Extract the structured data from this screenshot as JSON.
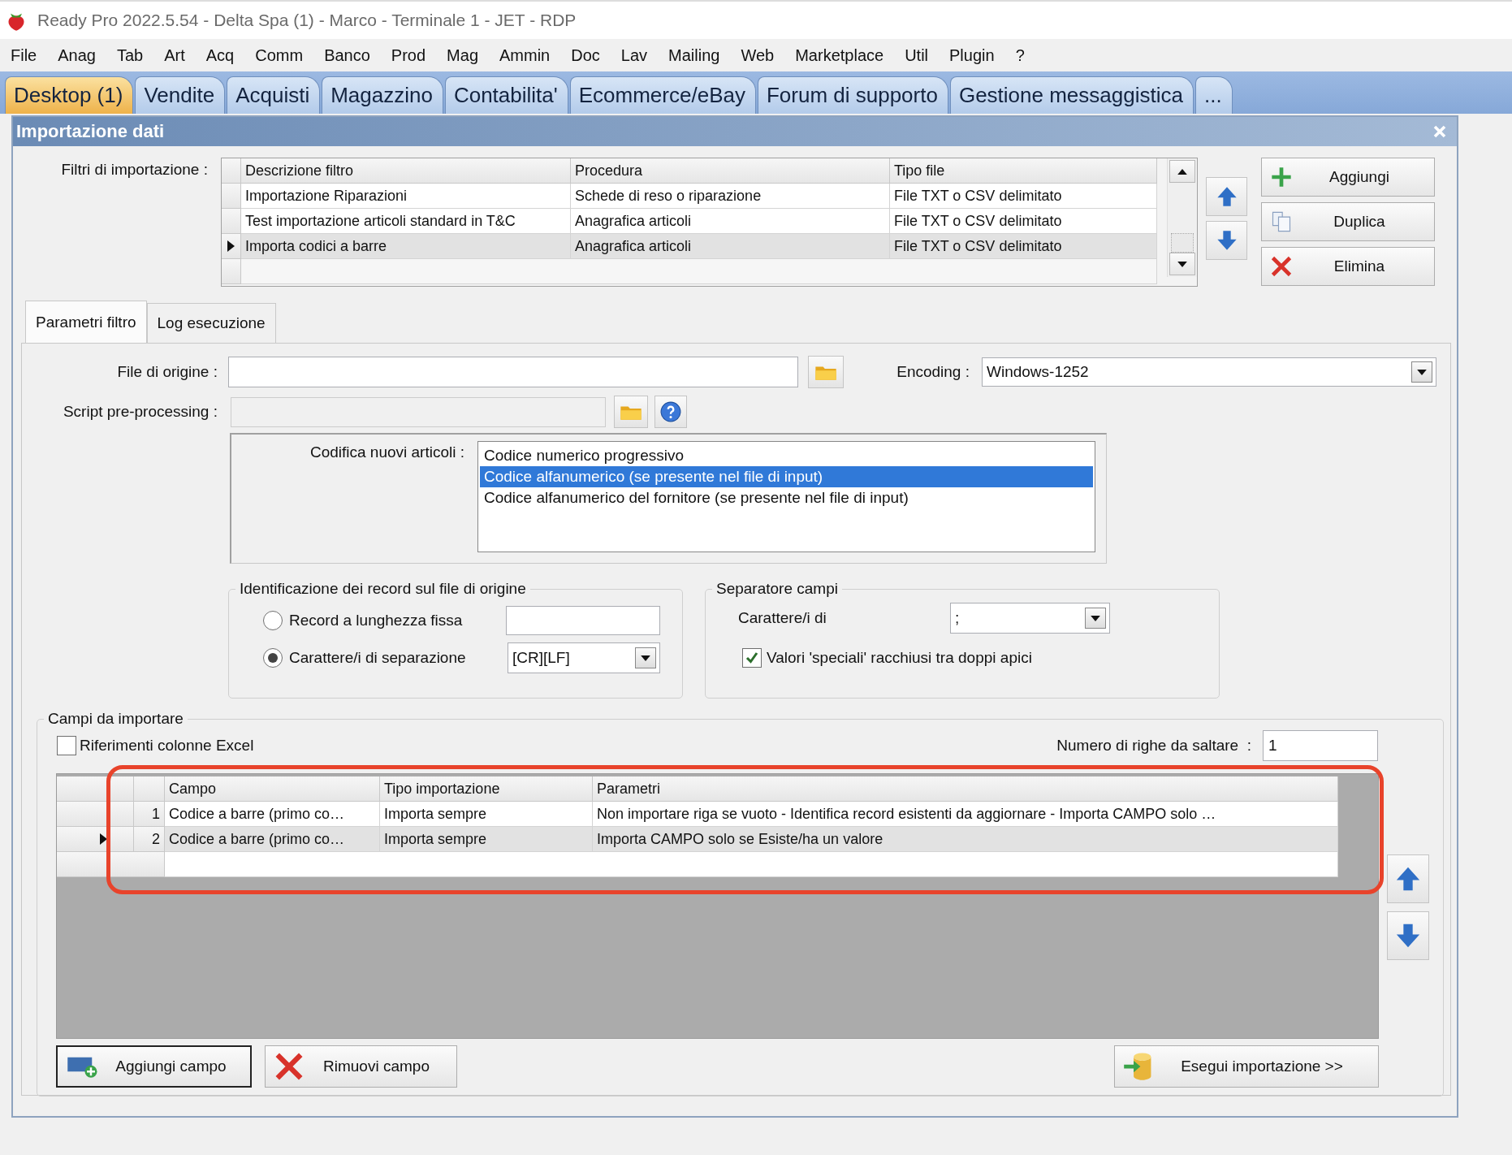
{
  "window": {
    "title": "Ready Pro 2022.5.54 - Delta Spa (1) - Marco - Terminale 1 - JET - RDP"
  },
  "menu": [
    "File",
    "Anag",
    "Tab",
    "Art",
    "Acq",
    "Comm",
    "Banco",
    "Prod",
    "Mag",
    "Ammin",
    "Doc",
    "Lav",
    "Mailing",
    "Web",
    "Marketplace",
    "Util",
    "Plugin",
    "?"
  ],
  "tabs": [
    {
      "label": "Desktop (1)",
      "selected": true
    },
    {
      "label": "Vendite",
      "selected": false
    },
    {
      "label": "Acquisti",
      "selected": false
    },
    {
      "label": "Magazzino",
      "selected": false
    },
    {
      "label": "Contabilita'",
      "selected": false
    },
    {
      "label": "Ecommerce/eBay",
      "selected": false
    },
    {
      "label": "Forum di supporto",
      "selected": false
    },
    {
      "label": "Gestione messaggistica",
      "selected": false
    },
    {
      "label": "...",
      "selected": false
    }
  ],
  "dialog": {
    "title": "Importazione dati",
    "filters": {
      "label": "Filtri di importazione :",
      "columns": [
        "Descrizione filtro",
        "Procedura",
        "Tipo file"
      ],
      "rows": [
        {
          "cells": [
            "Importazione Riparazioni",
            "Schede di reso o riparazione",
            "File TXT o CSV delimitato"
          ],
          "selected": false
        },
        {
          "cells": [
            "Test importazione articoli standard in T&C",
            "Anagrafica articoli",
            "File TXT o CSV delimitato"
          ],
          "selected": false
        },
        {
          "cells": [
            "Importa codici a barre",
            "Anagrafica articoli",
            "File TXT o CSV delimitato"
          ],
          "selected": true
        }
      ]
    },
    "filter_buttons": [
      {
        "label": "Aggiungi",
        "kind": "add"
      },
      {
        "label": "Duplica",
        "kind": "copy"
      },
      {
        "label": "Elimina",
        "kind": "delete"
      }
    ],
    "inner_tabs": [
      {
        "label": "Parametri filtro",
        "selected": true
      },
      {
        "label": "Log esecuzione",
        "selected": false
      }
    ],
    "source_file": {
      "label": "File di origine :"
    },
    "encoding": {
      "label": "Encoding :",
      "value": "Windows-1252"
    },
    "script": {
      "label": "Script pre-processing :",
      "disabled": true
    },
    "new_codes": {
      "label": "Codifica nuovi articoli :",
      "options": [
        {
          "label": "Codice numerico progressivo",
          "selected": false
        },
        {
          "label": "Codice alfanumerico (se presente nel file di input)",
          "selected": true
        },
        {
          "label": "Codice alfanumerico del fornitore (se presente nel file di input)",
          "selected": false
        }
      ]
    },
    "record_id": {
      "title": "Identificazione dei record sul file di origine",
      "options": [
        {
          "label": "Record a lunghezza fissa",
          "selected": false,
          "kind": "input"
        },
        {
          "label": "Carattere/i di separazione",
          "selected": true,
          "kind": "select",
          "value": "[CR][LF]"
        }
      ]
    },
    "separator": {
      "title": "Separatore campi",
      "label": "Carattere/i di",
      "value": ";",
      "quotes": {
        "label": "Valori 'speciali' racchiusi tra doppi apici",
        "checked": true
      }
    },
    "fields": {
      "title": "Campi da importare",
      "excel": {
        "label": "Riferimenti colonne Excel",
        "checked": false
      },
      "skip": {
        "label": "Numero di righe da saltare  :",
        "value": "1"
      },
      "columns": [
        "Campo",
        "Tipo importazione",
        "Parametri"
      ],
      "rows": [
        {
          "number": "1",
          "cells": [
            "Codice a barre (primo co…",
            "Importa sempre",
            "Non importare riga se vuoto - Identifica record esistenti da aggiornare - Importa CAMPO solo …"
          ],
          "selected": false
        },
        {
          "number": "2",
          "cells": [
            "Codice a barre (primo co…",
            "Importa sempre",
            "Importa CAMPO solo se Esiste/ha un valore"
          ],
          "selected": true
        }
      ]
    },
    "field_buttons": [
      {
        "label": "Aggiungi campo",
        "kind": "add-field"
      },
      {
        "label": "Rimuovi campo",
        "kind": "remove"
      },
      {
        "label": "Esegui importazione >>",
        "kind": "run"
      }
    ]
  }
}
